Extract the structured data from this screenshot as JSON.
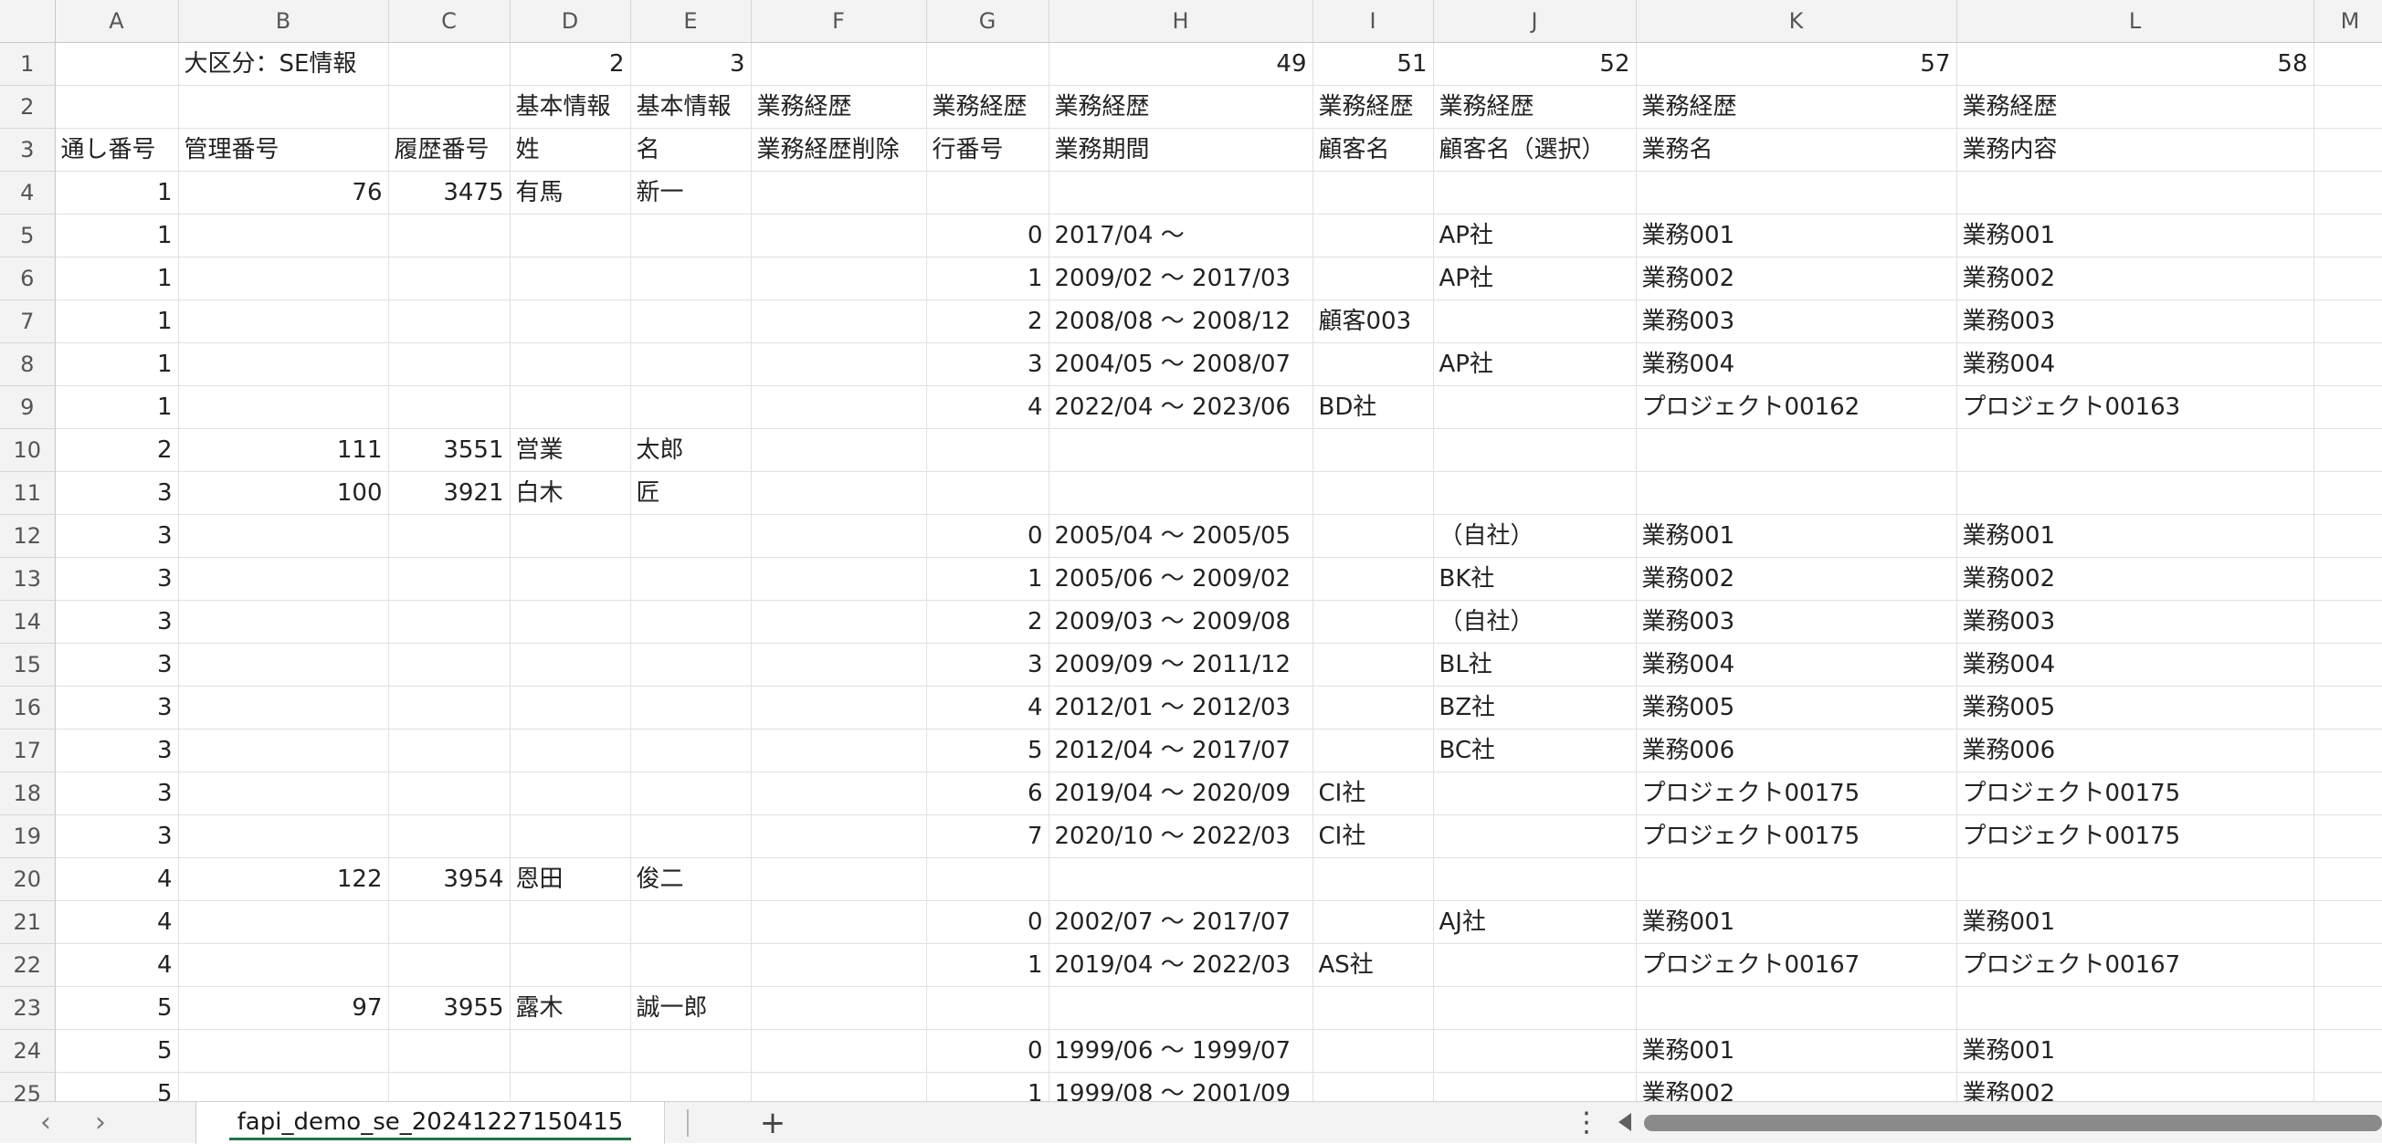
{
  "columns": [
    "A",
    "B",
    "C",
    "D",
    "E",
    "F",
    "G",
    "H",
    "I",
    "J",
    "K",
    "L",
    "M"
  ],
  "rows": [
    {
      "num": "1",
      "cells": [
        "",
        "大区分：SE情報",
        "",
        "2",
        "3",
        "",
        "",
        "49",
        "51",
        "52",
        "57",
        "58",
        ""
      ]
    },
    {
      "num": "2",
      "cells": [
        "",
        "",
        "",
        "基本情報",
        "基本情報",
        "業務経歴",
        "業務経歴",
        "業務経歴",
        "業務経歴",
        "業務経歴",
        "業務経歴",
        "業務経歴",
        ""
      ]
    },
    {
      "num": "3",
      "cells": [
        "通し番号",
        "管理番号",
        "履歴番号",
        "姓",
        "名",
        "業務経歴削除",
        "行番号",
        "業務期間",
        "顧客名",
        "顧客名（選択）",
        "業務名",
        "業務内容",
        ""
      ]
    },
    {
      "num": "4",
      "cells": [
        "1",
        "76",
        "3475",
        "有馬",
        "新一",
        "",
        "",
        "",
        "",
        "",
        "",
        "",
        ""
      ]
    },
    {
      "num": "5",
      "cells": [
        "1",
        "",
        "",
        "",
        "",
        "",
        "0",
        "2017/04 ～",
        "",
        "AP社",
        "業務001",
        "業務001",
        ""
      ]
    },
    {
      "num": "6",
      "cells": [
        "1",
        "",
        "",
        "",
        "",
        "",
        "1",
        "2009/02 ～ 2017/03",
        "",
        "AP社",
        "業務002",
        "業務002",
        ""
      ]
    },
    {
      "num": "7",
      "cells": [
        "1",
        "",
        "",
        "",
        "",
        "",
        "2",
        "2008/08 ～ 2008/12",
        "顧客003",
        "",
        "業務003",
        "業務003",
        ""
      ]
    },
    {
      "num": "8",
      "cells": [
        "1",
        "",
        "",
        "",
        "",
        "",
        "3",
        "2004/05 ～ 2008/07",
        "",
        "AP社",
        "業務004",
        "業務004",
        ""
      ]
    },
    {
      "num": "9",
      "cells": [
        "1",
        "",
        "",
        "",
        "",
        "",
        "4",
        "2022/04 ～ 2023/06",
        "BD社",
        "",
        "プロジェクト00162",
        "プロジェクト00163",
        ""
      ]
    },
    {
      "num": "10",
      "cells": [
        "2",
        "111",
        "3551",
        "営業",
        "太郎",
        "",
        "",
        "",
        "",
        "",
        "",
        "",
        ""
      ]
    },
    {
      "num": "11",
      "cells": [
        "3",
        "100",
        "3921",
        "白木",
        "匠",
        "",
        "",
        "",
        "",
        "",
        "",
        "",
        ""
      ]
    },
    {
      "num": "12",
      "cells": [
        "3",
        "",
        "",
        "",
        "",
        "",
        "0",
        "2005/04 ～ 2005/05",
        "",
        "（自社）",
        "業務001",
        "業務001",
        ""
      ]
    },
    {
      "num": "13",
      "cells": [
        "3",
        "",
        "",
        "",
        "",
        "",
        "1",
        "2005/06 ～ 2009/02",
        "",
        "BK社",
        "業務002",
        "業務002",
        ""
      ]
    },
    {
      "num": "14",
      "cells": [
        "3",
        "",
        "",
        "",
        "",
        "",
        "2",
        "2009/03 ～ 2009/08",
        "",
        "（自社）",
        "業務003",
        "業務003",
        ""
      ]
    },
    {
      "num": "15",
      "cells": [
        "3",
        "",
        "",
        "",
        "",
        "",
        "3",
        "2009/09 ～ 2011/12",
        "",
        "BL社",
        "業務004",
        "業務004",
        ""
      ]
    },
    {
      "num": "16",
      "cells": [
        "3",
        "",
        "",
        "",
        "",
        "",
        "4",
        "2012/01 ～ 2012/03",
        "",
        "BZ社",
        "業務005",
        "業務005",
        ""
      ]
    },
    {
      "num": "17",
      "cells": [
        "3",
        "",
        "",
        "",
        "",
        "",
        "5",
        "2012/04 ～ 2017/07",
        "",
        "BC社",
        "業務006",
        "業務006",
        ""
      ]
    },
    {
      "num": "18",
      "cells": [
        "3",
        "",
        "",
        "",
        "",
        "",
        "6",
        "2019/04 ～ 2020/09",
        "CI社",
        "",
        "プロジェクト00175",
        "プロジェクト00175",
        ""
      ]
    },
    {
      "num": "19",
      "cells": [
        "3",
        "",
        "",
        "",
        "",
        "",
        "7",
        "2020/10 ～ 2022/03",
        "CI社",
        "",
        "プロジェクト00175",
        "プロジェクト00175",
        ""
      ]
    },
    {
      "num": "20",
      "cells": [
        "4",
        "122",
        "3954",
        "恩田",
        "俊二",
        "",
        "",
        "",
        "",
        "",
        "",
        "",
        ""
      ]
    },
    {
      "num": "21",
      "cells": [
        "4",
        "",
        "",
        "",
        "",
        "",
        "0",
        "2002/07 ～ 2017/07",
        "",
        "AJ社",
        "業務001",
        "業務001",
        ""
      ]
    },
    {
      "num": "22",
      "cells": [
        "4",
        "",
        "",
        "",
        "",
        "",
        "1",
        "2019/04 ～ 2022/03",
        "AS社",
        "",
        "プロジェクト00167",
        "プロジェクト00167",
        ""
      ]
    },
    {
      "num": "23",
      "cells": [
        "5",
        "97",
        "3955",
        "露木",
        "誠一郎",
        "",
        "",
        "",
        "",
        "",
        "",
        "",
        ""
      ]
    },
    {
      "num": "24",
      "cells": [
        "5",
        "",
        "",
        "",
        "",
        "",
        "0",
        "1999/06 ～ 1999/07",
        "",
        "",
        "業務001",
        "業務001",
        ""
      ]
    },
    {
      "num": "25",
      "cells": [
        "5",
        "",
        "",
        "",
        "",
        "",
        "1",
        "1999/08 ～ 2001/09",
        "",
        "",
        "業務002",
        "業務002",
        ""
      ]
    }
  ],
  "footer": {
    "prev_icon": "‹",
    "next_icon": "›",
    "sheet_tab": "fapi_demo_se_20241227150415",
    "add_icon": "+",
    "more_icon": "⋮"
  },
  "colors": {
    "active_tab_underline": "#217346",
    "header_background": "#f3f3f3",
    "gridline": "#e1e1e1"
  }
}
